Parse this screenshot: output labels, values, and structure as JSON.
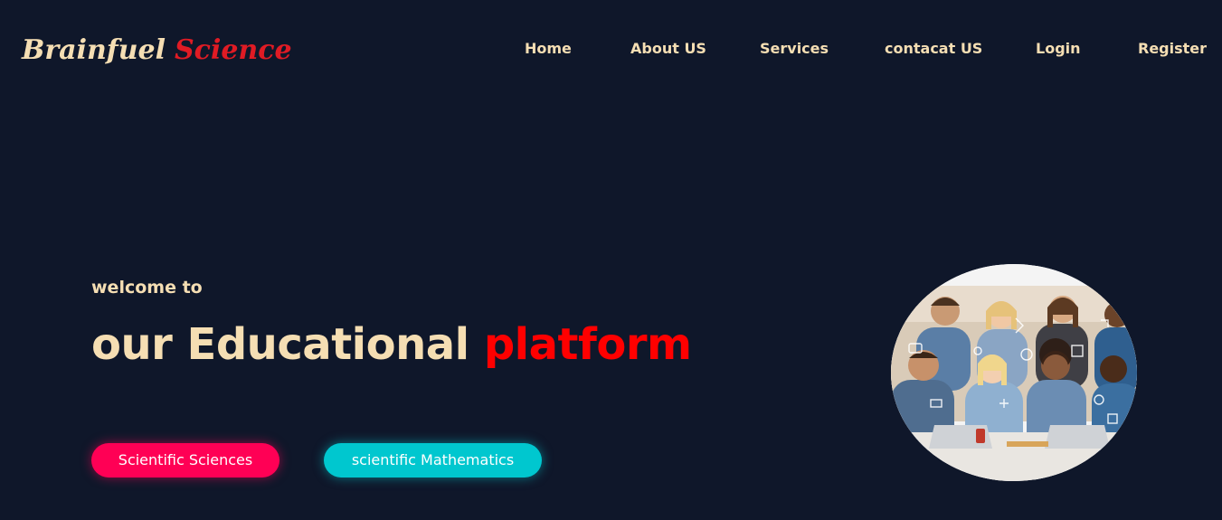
{
  "header": {
    "logo_part1": "Brainfuel",
    "logo_part2": "Science",
    "nav": {
      "home": "Home",
      "about": "About US",
      "services": "Services",
      "contact": "contacat US",
      "login": "Login",
      "register": "Register"
    }
  },
  "hero": {
    "welcome": "welcome to",
    "headline_part1": "our Educational",
    "headline_part2": "platform",
    "buttons": {
      "sciences": "Scientific Sciences",
      "mathematics": "scientific Mathematics"
    },
    "image_icon": "students-group-photo"
  },
  "colors": {
    "background": "#0f172a",
    "cream": "#f5deb3",
    "red": "#ff0000",
    "pink_button": "#ff0055",
    "teal_button": "#00c7cf"
  }
}
